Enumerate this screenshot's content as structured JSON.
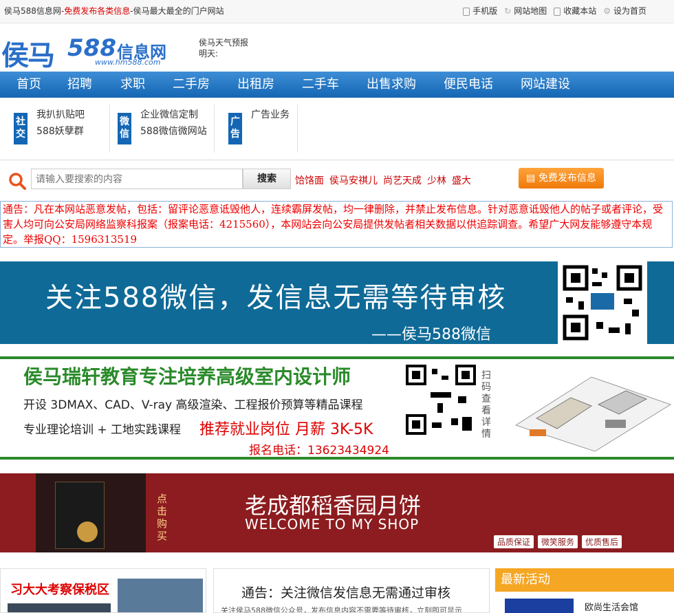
{
  "topbar": {
    "site_name": "侯马588信息网",
    "free_post": "-免费发布各类信息",
    "slogan": "-侯马最大最全的门户网站",
    "links": [
      "手机版",
      "网站地图",
      "收藏本站",
      "设为首页"
    ]
  },
  "logo": {
    "part1": "侯马",
    "part2": "588",
    "part3": "信息网",
    "url": "www.hm588.com"
  },
  "weather": {
    "title": "侯马天气预报",
    "tomorrow": "明天:"
  },
  "nav": {
    "items": [
      "首页",
      "招聘",
      "求职",
      "二手房",
      "出租房",
      "二手车",
      "出售求购",
      "便民电话",
      "网站建设"
    ]
  },
  "subrow": {
    "groups": [
      {
        "badge": "社交",
        "line1": "我扒扒贴吧",
        "line2": "588妖孽群"
      },
      {
        "badge": "微信",
        "line1": "企业微信定制",
        "line2": "588微信微网站"
      },
      {
        "badge": "广告",
        "line1": "广告业务",
        "line2": ""
      }
    ]
  },
  "search": {
    "placeholder": "请输入要搜索的内容",
    "button": "搜索",
    "hotwords": [
      "饸饹面",
      "侯马安祺儿",
      "尚艺天成",
      "少林",
      "盛大"
    ],
    "post_button": "免费发布信息"
  },
  "notice": {
    "text": "通告：凡在本网站恶意发帖，包括：留评论恶意诋毁他人，连续霸屏发帖，均一律删除，并禁止发布信息。针对恶意诋毁他人的帖子或者评论，受害人均可向公安局网络监察科报案（报案电话：4215560），本网站会向公安局提供发帖者相关数据以供追踪调查。希望广大网友能够遵守本规定。举报QQ：1596313519"
  },
  "banner1": {
    "headline": "关注588微信，发信息无需等待审核",
    "sub": "——侯马588微信"
  },
  "banner2": {
    "headline": "侯马瑞轩教育专注培养高级室内设计师",
    "line1": "开设 3DMAX、CAD、V-ray 高级渲染、工程报价预算等精品课程",
    "line2": "专业理论培训 + 工地实践课程",
    "line2_right": "推荐就业岗位  月薪 3K-5K",
    "phone": "报名电话：13623434924",
    "side": "扫码查看详情"
  },
  "banner3": {
    "vert": "点击购买",
    "headline": "老成都稻香园月饼",
    "sub": "WELCOME TO MY SHOP",
    "tags": [
      "品质保证",
      "微笑服务",
      "优质售后"
    ]
  },
  "columns": {
    "col1_title": "习大大考察保税区",
    "col2_title": "通告：关注微信发信息无需通过审核",
    "col2_sub": "关注侯马588微信公众号，发布信息内容不需要等待审核，立刻即可显示",
    "col3_title": "最新活动",
    "col3_item": "欧尚生活会馆"
  },
  "colors": {
    "nav_blue": "#1466b4",
    "notice_red": "#e00000",
    "post_orange": "#f07a0a",
    "banner1_bg": "#0f6a97",
    "banner3_bg": "#8c1c1f"
  }
}
